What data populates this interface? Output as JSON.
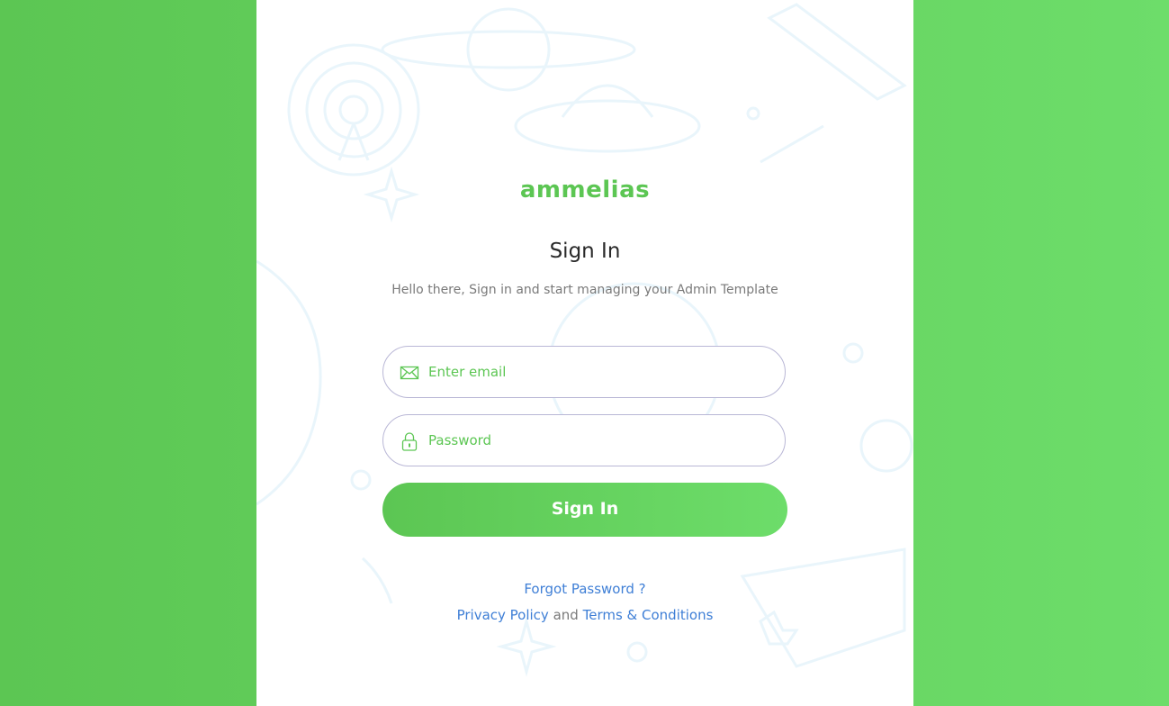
{
  "brand": {
    "name": "ammelias",
    "color": "#5cc653"
  },
  "signin": {
    "title": "Sign In",
    "subtitle": "Hello there, Sign in and start managing your Admin Template"
  },
  "form": {
    "email": {
      "placeholder": "Enter email",
      "icon": "envelope-icon"
    },
    "password": {
      "placeholder": "Password",
      "icon": "lock-icon"
    },
    "submit_label": "Sign In"
  },
  "links": {
    "forgot_password": "Forgot Password ?",
    "privacy_policy": "Privacy Policy",
    "and": "and",
    "terms": "Terms & Conditions",
    "link_color": "#3f7fd6"
  },
  "colors": {
    "background_start": "#5cc653",
    "background_end": "#6ddd6a",
    "field_border": "#b9b7d6"
  }
}
